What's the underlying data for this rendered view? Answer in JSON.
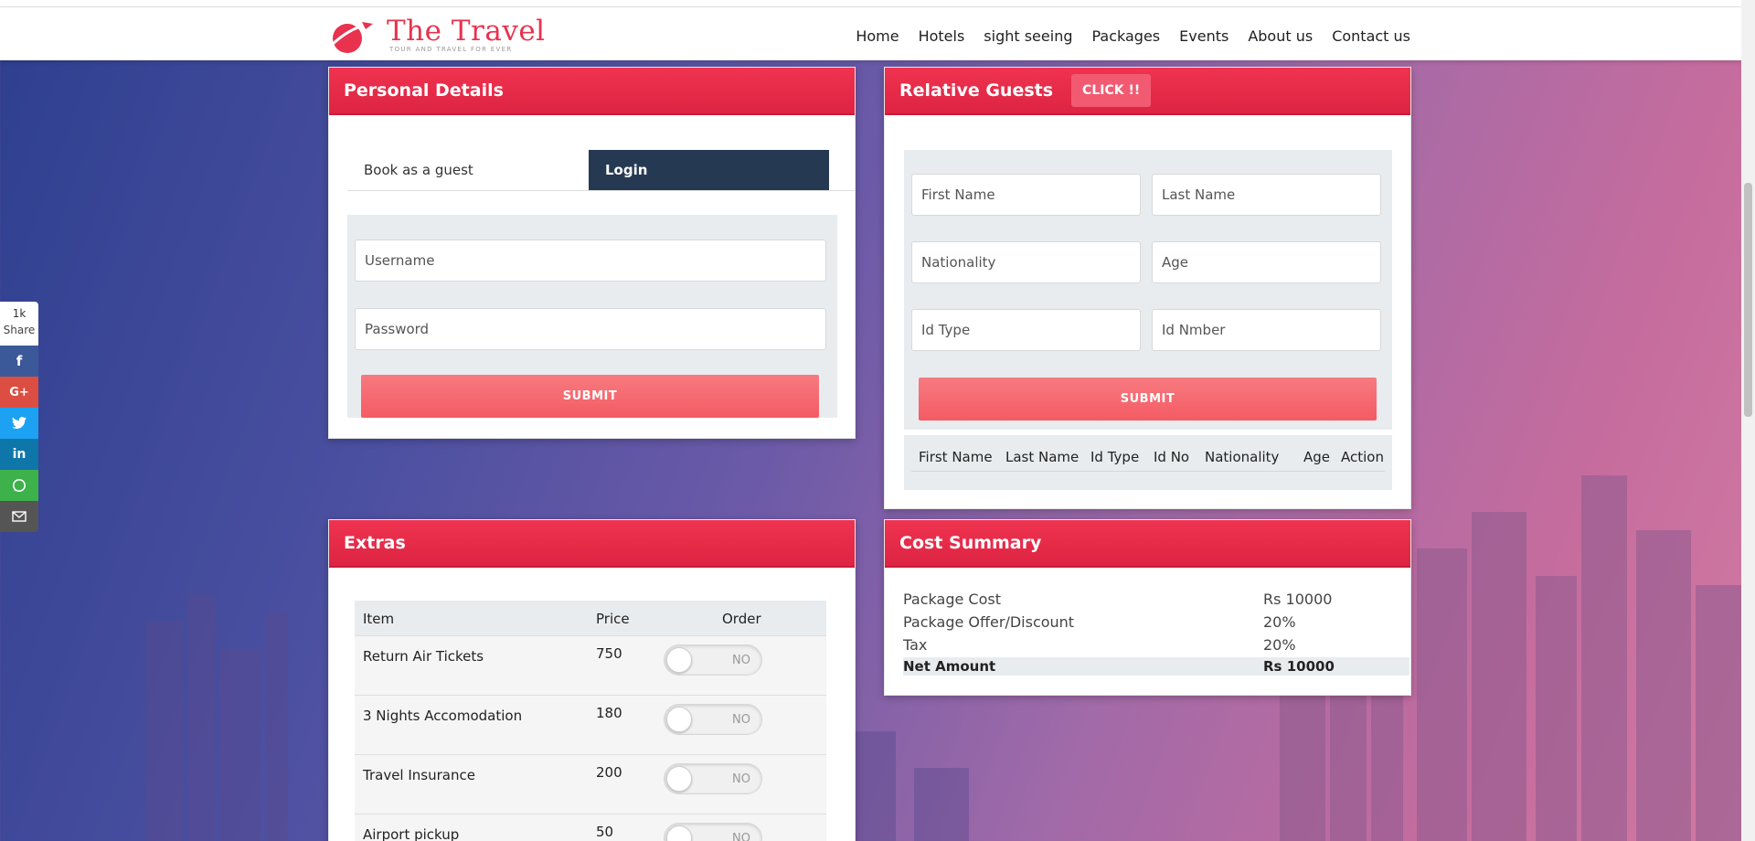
{
  "brand": {
    "name": "The Travel",
    "tagline": "TOUR AND TRAVEL FOR EVER"
  },
  "nav": [
    "Home",
    "Hotels",
    "sight seeing",
    "Packages",
    "Events",
    "About us",
    "Contact us"
  ],
  "personal": {
    "title": "Personal Details",
    "tab_guest": "Book as a guest",
    "tab_login": "Login",
    "username_placeholder": "Username",
    "password_placeholder": "Password",
    "submit": "SUBMIT"
  },
  "relative": {
    "title": "Relative Guests",
    "click": "CLICK !!",
    "first_name": "First Name",
    "last_name": "Last Name",
    "nationality": "Nationality",
    "age": "Age",
    "id_type": "Id Type",
    "id_number": "Id Nmber",
    "submit": "SUBMIT",
    "columns": [
      "First Name",
      "Last Name",
      "Id Type",
      "Id No",
      "Nationality",
      "Age",
      "Action"
    ]
  },
  "extras": {
    "title": "Extras",
    "headers": {
      "item": "Item",
      "price": "Price",
      "order": "Order"
    },
    "rows": [
      {
        "item": "Return Air Tickets",
        "price": "750",
        "order": "NO"
      },
      {
        "item": "3 Nights Accomodation",
        "price": "180",
        "order": "NO"
      },
      {
        "item": "Travel Insurance",
        "price": "200",
        "order": "NO"
      },
      {
        "item": "Airport pickup",
        "price": "50",
        "order": "NO"
      }
    ]
  },
  "cost": {
    "title": "Cost Summary",
    "rows": [
      {
        "label": "Package Cost",
        "value": "Rs 10000"
      },
      {
        "label": "Package Offer/Discount",
        "value": "20%"
      },
      {
        "label": "Tax",
        "value": "20%"
      },
      {
        "label": "Net Amount",
        "value": "Rs 10000"
      }
    ]
  },
  "share": {
    "count": "1k",
    "label": "Share"
  },
  "colors": {
    "accent": "#e32a48",
    "submit": "#f45b63",
    "login_tab": "#253a52"
  }
}
